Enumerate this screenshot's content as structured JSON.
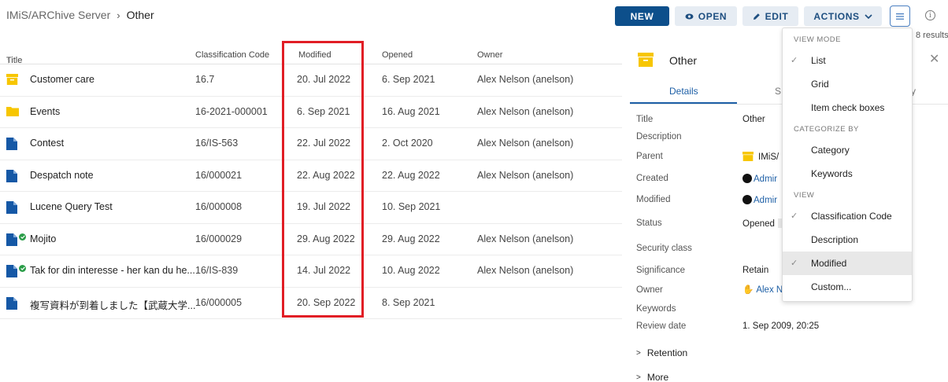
{
  "breadcrumb": {
    "root": "IMiS/ARChive Server",
    "separator": "›",
    "current": "Other"
  },
  "toolbar": {
    "new_label": "NEW",
    "open_label": "OPEN",
    "edit_label": "EDIT",
    "actions_label": "ACTIONS"
  },
  "results_count": "8 results",
  "table": {
    "headers": {
      "title": "Title",
      "code": "Classification Code",
      "modified": "Modified",
      "opened": "Opened",
      "owner": "Owner"
    },
    "rows": [
      {
        "icon": "box-folder-icon",
        "title": "Customer care",
        "code": "16.7",
        "modified": "20. Jul 2022",
        "opened": "6. Sep 2021",
        "owner": "Alex Nelson (anelson)"
      },
      {
        "icon": "folder-icon",
        "title": "Events",
        "code": "16-2021-000001",
        "modified": "6. Sep 2021",
        "opened": "16. Aug 2021",
        "owner": "Alex Nelson (anelson)"
      },
      {
        "icon": "document-icon",
        "title": "Contest",
        "code": "16/IS-563",
        "modified": "22. Jul 2022",
        "opened": "2. Oct 2020",
        "owner": "Alex Nelson (anelson)"
      },
      {
        "icon": "document-icon",
        "title": "Despatch note",
        "code": "16/000021",
        "modified": "22. Aug 2022",
        "opened": "22. Aug 2022",
        "owner": "Alex Nelson (anelson)"
      },
      {
        "icon": "document-icon",
        "title": "Lucene Query Test",
        "code": "16/000008",
        "modified": "19. Jul 2022",
        "opened": "10. Sep 2021",
        "owner": ""
      },
      {
        "icon": "document-icon",
        "checked": true,
        "title": "Mojito",
        "code": "16/000029",
        "modified": "29. Aug 2022",
        "opened": "29. Aug 2022",
        "owner": "Alex Nelson (anelson)"
      },
      {
        "icon": "document-icon",
        "checked": true,
        "title": "Tak for din interesse - her kan du he...",
        "code": "16/IS-839",
        "modified": "14. Jul 2022",
        "opened": "10. Aug 2022",
        "owner": "Alex Nelson (anelson)"
      },
      {
        "icon": "document-icon",
        "title": "複写資料が到着しました【武蔵大学...",
        "code": "16/000005",
        "modified": "20. Sep 2022",
        "opened": "8. Sep 2021",
        "owner": ""
      }
    ]
  },
  "panel": {
    "title": "Other",
    "tabs": [
      "Details",
      "S",
      "y"
    ],
    "details": [
      {
        "label": "Title",
        "value": "Other"
      },
      {
        "label": "Description",
        "value": ""
      },
      {
        "label": "Parent",
        "value": "IMiS/"
      },
      {
        "label": "Created",
        "value": "Admir"
      },
      {
        "label": "Modified",
        "value": "Admir"
      },
      {
        "label": "Status",
        "value": "Opened"
      },
      {
        "label": "Security class",
        "value": ""
      },
      {
        "label": "Significance",
        "value": "Retain"
      },
      {
        "label": "Owner",
        "value": "Alex N"
      },
      {
        "label": "Keywords",
        "value": ""
      },
      {
        "label": "Review date",
        "value": "1. Sep 2009, 20:25"
      }
    ],
    "retention_label": "Retention",
    "more_label": "More"
  },
  "menu": {
    "view_mode_header": "VIEW MODE",
    "categorize_header": "CATEGORIZE BY",
    "view_header": "VIEW",
    "items": [
      {
        "label": "List",
        "checked": true
      },
      {
        "label": "Grid",
        "checked": false
      },
      {
        "label": "Item check boxes",
        "checked": false
      },
      {
        "label": "Category",
        "checked": false
      },
      {
        "label": "Keywords",
        "checked": false
      },
      {
        "label": "Classification Code",
        "checked": true
      },
      {
        "label": "Description",
        "checked": false
      },
      {
        "label": "Modified",
        "checked": true
      },
      {
        "label": "Custom...",
        "checked": false
      }
    ]
  },
  "colors": {
    "primary": "#0d4f8b",
    "folder_yellow": "#f7c600",
    "doc_blue": "#1558a6",
    "highlight_red": "#e11d25",
    "check_green": "#2a9d48"
  }
}
